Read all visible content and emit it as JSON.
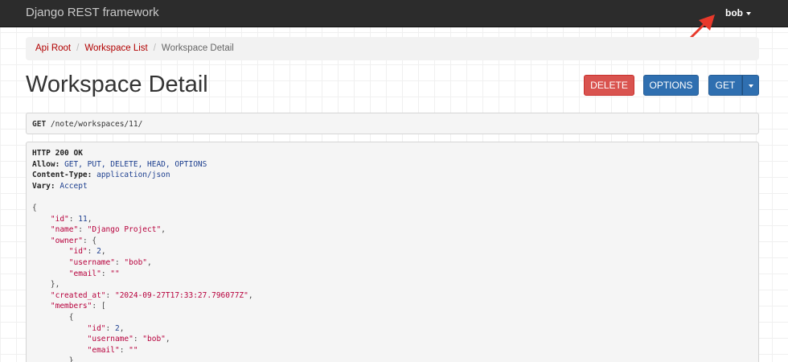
{
  "navbar": {
    "brand": "Django REST framework",
    "user": "bob"
  },
  "breadcrumb": {
    "items": [
      "Api Root",
      "Workspace List"
    ],
    "active": "Workspace Detail",
    "separator": "/"
  },
  "page": {
    "title": "Workspace Detail"
  },
  "buttons": {
    "delete": "DELETE",
    "options": "OPTIONS",
    "get": "GET"
  },
  "request": {
    "method": "GET",
    "path": "/note/workspaces/11/"
  },
  "response": {
    "status": "HTTP 200 OK",
    "headers": [
      {
        "key": "Allow:",
        "value": "GET, PUT, DELETE, HEAD, OPTIONS"
      },
      {
        "key": "Content-Type:",
        "value": "application/json"
      },
      {
        "key": "Vary:",
        "value": "Accept"
      }
    ],
    "body_lines": [
      {
        "indent": 0,
        "parts": [
          [
            "punc",
            "{"
          ]
        ]
      },
      {
        "indent": 4,
        "parts": [
          [
            "jkey",
            "\"id\""
          ],
          [
            "punc",
            ": "
          ],
          [
            "jnum",
            "11"
          ],
          [
            "punc",
            ","
          ]
        ]
      },
      {
        "indent": 4,
        "parts": [
          [
            "jkey",
            "\"name\""
          ],
          [
            "punc",
            ": "
          ],
          [
            "jstr",
            "\"Django Project\""
          ],
          [
            "punc",
            ","
          ]
        ]
      },
      {
        "indent": 4,
        "parts": [
          [
            "jkey",
            "\"owner\""
          ],
          [
            "punc",
            ": {"
          ]
        ]
      },
      {
        "indent": 8,
        "parts": [
          [
            "jkey",
            "\"id\""
          ],
          [
            "punc",
            ": "
          ],
          [
            "jnum",
            "2"
          ],
          [
            "punc",
            ","
          ]
        ]
      },
      {
        "indent": 8,
        "parts": [
          [
            "jkey",
            "\"username\""
          ],
          [
            "punc",
            ": "
          ],
          [
            "jstr",
            "\"bob\""
          ],
          [
            "punc",
            ","
          ]
        ]
      },
      {
        "indent": 8,
        "parts": [
          [
            "jkey",
            "\"email\""
          ],
          [
            "punc",
            ": "
          ],
          [
            "jstr",
            "\"\""
          ]
        ]
      },
      {
        "indent": 4,
        "parts": [
          [
            "punc",
            "},"
          ]
        ]
      },
      {
        "indent": 4,
        "parts": [
          [
            "jkey",
            "\"created_at\""
          ],
          [
            "punc",
            ": "
          ],
          [
            "jstr",
            "\"2024-09-27T17:33:27.796077Z\""
          ],
          [
            "punc",
            ","
          ]
        ]
      },
      {
        "indent": 4,
        "parts": [
          [
            "jkey",
            "\"members\""
          ],
          [
            "punc",
            ": ["
          ]
        ]
      },
      {
        "indent": 8,
        "parts": [
          [
            "punc",
            "{"
          ]
        ]
      },
      {
        "indent": 12,
        "parts": [
          [
            "jkey",
            "\"id\""
          ],
          [
            "punc",
            ": "
          ],
          [
            "jnum",
            "2"
          ],
          [
            "punc",
            ","
          ]
        ]
      },
      {
        "indent": 12,
        "parts": [
          [
            "jkey",
            "\"username\""
          ],
          [
            "punc",
            ": "
          ],
          [
            "jstr",
            "\"bob\""
          ],
          [
            "punc",
            ","
          ]
        ]
      },
      {
        "indent": 12,
        "parts": [
          [
            "jkey",
            "\"email\""
          ],
          [
            "punc",
            ": "
          ],
          [
            "jstr",
            "\"\""
          ]
        ]
      },
      {
        "indent": 8,
        "parts": [
          [
            "punc",
            "}"
          ]
        ]
      }
    ]
  },
  "annotation": {
    "arrow_color": "#e8392b"
  }
}
